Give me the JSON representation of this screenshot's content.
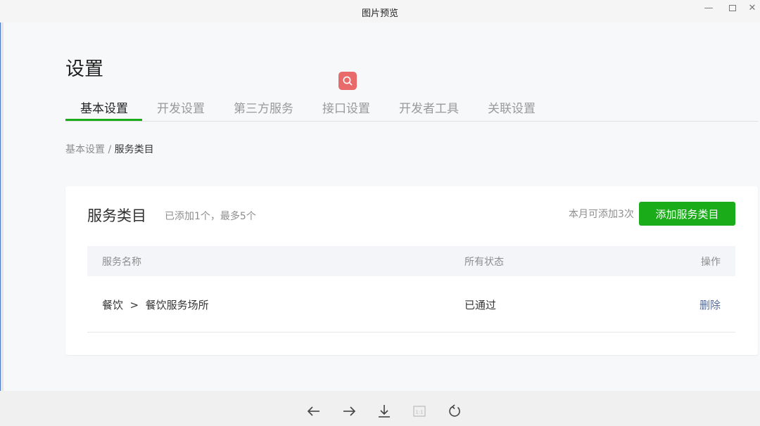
{
  "window": {
    "title": "图片预览",
    "minimize": "—",
    "close": "✕"
  },
  "page": {
    "title": "设置"
  },
  "tabs": [
    {
      "label": "基本设置",
      "active": true
    },
    {
      "label": "开发设置",
      "active": false
    },
    {
      "label": "第三方服务",
      "active": false
    },
    {
      "label": "接口设置",
      "active": false
    },
    {
      "label": "开发者工具",
      "active": false
    },
    {
      "label": "关联设置",
      "active": false
    }
  ],
  "breadcrumb": {
    "parent": "基本设置",
    "separator": " / ",
    "current": "服务类目"
  },
  "panel": {
    "title": "服务类目",
    "subtitle": "已添加1个，最多5个",
    "quota": "本月可添加3次",
    "add_button": "添加服务类目",
    "columns": [
      "服务名称",
      "所有状态",
      "操作"
    ],
    "rows": [
      {
        "name": "餐饮  >  餐饮服务场所",
        "status": "已通过",
        "action": "删除"
      }
    ]
  },
  "toolbar": {
    "icons": [
      "arrow-left-icon",
      "arrow-right-icon",
      "download-icon",
      "actual-size-icon",
      "rotate-icon"
    ],
    "actual_size_label": "1:1"
  },
  "colors": {
    "accent": "#1aad19",
    "link": "#576b95",
    "search_badge": "#e86a6a"
  }
}
